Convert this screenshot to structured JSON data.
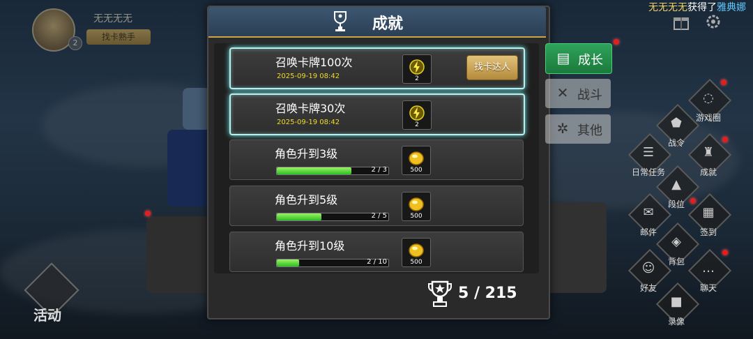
{
  "notice": {
    "who": "无无无无",
    "mid": "获得了",
    "item": "雅典娜"
  },
  "player": {
    "name": "无无无无",
    "title": "找卡熟手",
    "level": "2"
  },
  "dialog": {
    "title": "成就"
  },
  "achievements": [
    {
      "title": "召唤卡牌100次",
      "date": "2025-09-19 08:42",
      "reward_type": "lightning-icon",
      "reward_count": "2",
      "completed": true,
      "button": "找卡达人"
    },
    {
      "title": "召唤卡牌30次",
      "date": "2025-09-19 08:42",
      "reward_type": "lightning-icon",
      "reward_count": "2",
      "completed": true
    },
    {
      "title": "角色升到3级",
      "reward_type": "gold-coin-icon",
      "reward_count": "500",
      "progress_text": "2 / 3",
      "progress": 0.6667
    },
    {
      "title": "角色升到5级",
      "reward_type": "gold-coin-icon",
      "reward_count": "500",
      "progress_text": "2 / 5",
      "progress": 0.4
    },
    {
      "title": "角色升到10级",
      "reward_type": "gold-coin-icon",
      "reward_count": "500",
      "progress_text": "2 / 10",
      "progress": 0.2
    }
  ],
  "footer": {
    "count": "5 / 215"
  },
  "tabs": [
    {
      "label": "成长",
      "icon": "page-icon",
      "active": true
    },
    {
      "label": "战斗",
      "icon": "swords-icon",
      "active": false
    },
    {
      "label": "其他",
      "icon": "gear-icon",
      "active": false
    }
  ],
  "menu": {
    "chat_group": "游戏圈",
    "war_order": "战令",
    "daily": "日常任务",
    "achievement": "成就",
    "rank": "段位",
    "mail": "邮件",
    "signin": "签到",
    "bag": "背包",
    "friends": "好友",
    "chat": "聊天",
    "record": "录像"
  },
  "activity": {
    "label": "活动"
  },
  "colors": {
    "accent_green": "#2fa25a",
    "gold": "#c9a84a",
    "date_yellow": "#f2dc2c",
    "glow": "#b8f0f0"
  }
}
